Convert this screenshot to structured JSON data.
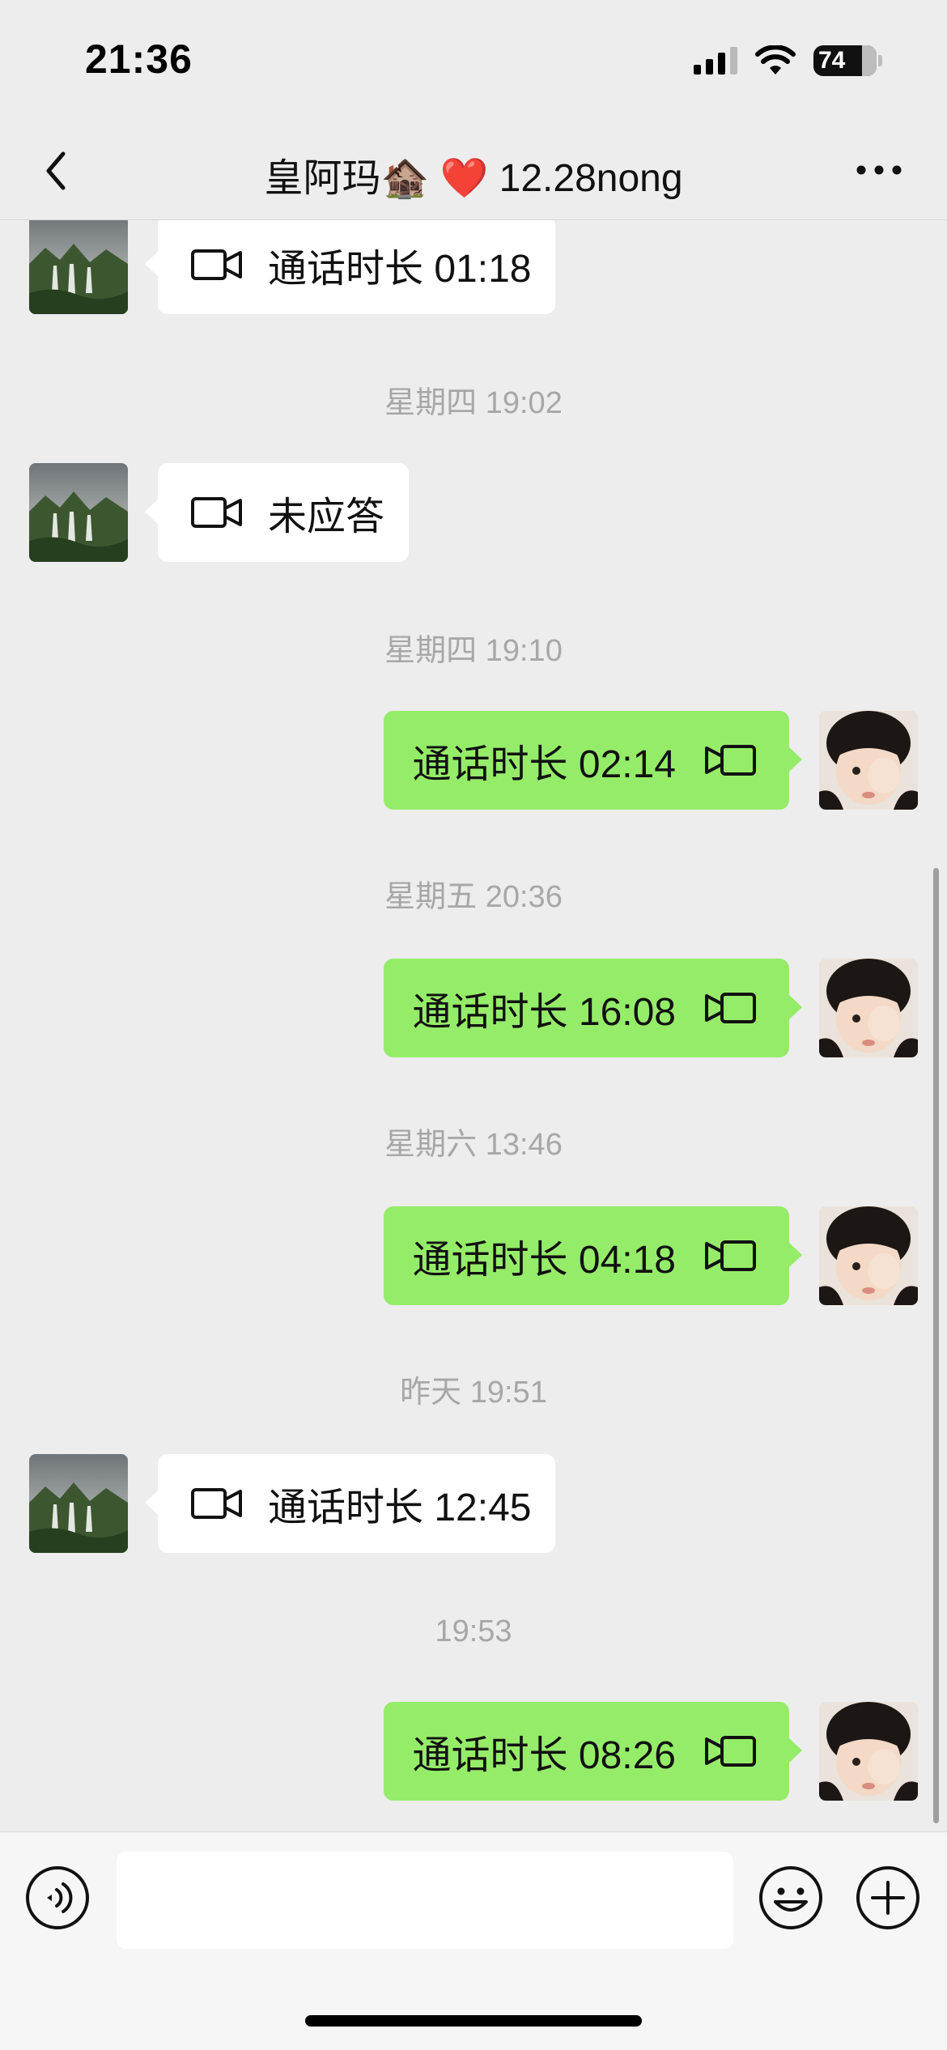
{
  "status_bar": {
    "time": "21:36",
    "battery": "74",
    "icons": [
      "signal-icon",
      "wifi-icon",
      "battery-icon"
    ]
  },
  "nav": {
    "title": "皇阿玛🏚️ ❤️ 12.28nong",
    "back_icon": "chevron-left-icon",
    "more_icon": "more-dots-icon"
  },
  "messages": [
    {
      "type": "call",
      "direction": "in",
      "text": "通话时长 01:18"
    },
    {
      "type": "time",
      "text": "星期四 19:02"
    },
    {
      "type": "call",
      "direction": "in",
      "text": "未应答"
    },
    {
      "type": "time",
      "text": "星期四 19:10"
    },
    {
      "type": "call",
      "direction": "out",
      "text": "通话时长 02:14"
    },
    {
      "type": "time",
      "text": "星期五 20:36"
    },
    {
      "type": "call",
      "direction": "out",
      "text": "通话时长 16:08"
    },
    {
      "type": "time",
      "text": "星期六 13:46"
    },
    {
      "type": "call",
      "direction": "out",
      "text": "通话时长 04:18"
    },
    {
      "type": "time",
      "text": "昨天 19:51"
    },
    {
      "type": "call",
      "direction": "in",
      "text": "通话时长 12:45"
    },
    {
      "type": "time",
      "text": "19:53"
    },
    {
      "type": "call",
      "direction": "out",
      "text": "通话时长 08:26"
    }
  ],
  "input_bar": {
    "message_value": "",
    "icons": [
      "voice-icon",
      "emoji-icon",
      "plus-icon"
    ]
  },
  "colors": {
    "background": "#ededed",
    "incoming_bubble": "#ffffff",
    "outgoing_bubble": "#95ec69",
    "timestamp": "#a7a7a7"
  }
}
